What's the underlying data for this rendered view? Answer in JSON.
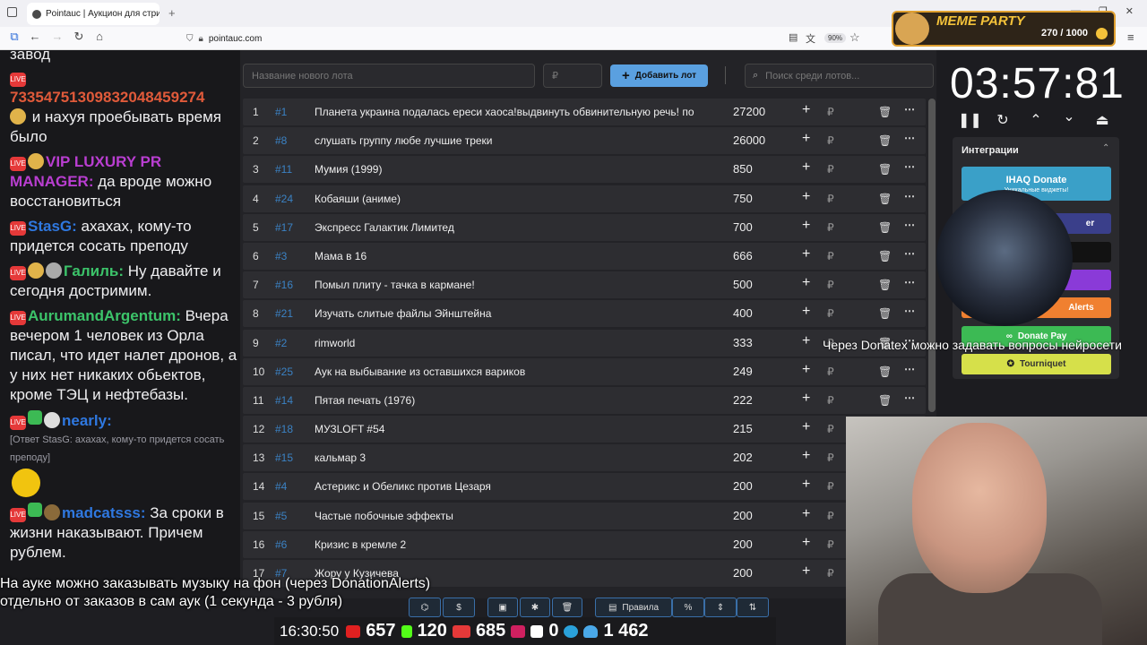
{
  "browser": {
    "tab_title": "Pointauc | Аукцион для стриме",
    "url": "pointauc.com",
    "zoom": "90%"
  },
  "meme_party": {
    "title": "MEME PARTY",
    "count": "270 / 1000"
  },
  "chat": {
    "top_word": "завод",
    "messages": [
      {
        "nick": "733547513098320484592​74",
        "nick_display": "7335475130983204845927​4",
        "color": "#e05a3a",
        "text": " и нахуя проебывать время было"
      },
      {
        "nick": "VIP LUXURY PR MANAGER:",
        "color": "#b93ed1",
        "text": " да вроде можно восстановиться"
      },
      {
        "nick": "StasG:",
        "color": "#2f78e0",
        "text": " ахахах, кому-то придется сосать преподу"
      },
      {
        "nick": "Галиль:",
        "color": "#3cc46a",
        "text": " Ну давайте и сегодня достримим."
      },
      {
        "nick": "AurumandArgentum:",
        "color": "#3cc46a",
        "text": " Вчера вечером 1 человек из Орла писал, что идет налет дронов, а у них нет никаких обьектов, кроме ТЭЦ и нефтебазы."
      },
      {
        "nick": "nearly:",
        "color": "#2f78e0",
        "text": ""
      },
      {
        "nick": "madcatsss:",
        "color": "#2f78e0",
        "text": " За сроки в жизни наказывают. Причем рублем."
      }
    ],
    "reply": "[Ответ StasG: ахахах, кому-то придется сосать преподу]"
  },
  "auction": {
    "lot_placeholder": "Название нового лота",
    "price_placeholder": "₽",
    "add_label": "Добавить лот",
    "search_placeholder": "Поиск среди лотов...",
    "lots": [
      {
        "n": "1",
        "id": "#1",
        "title": "Планета украина подалась ереси хаоса!выдвинуть обвинительную речь! по",
        "value": "27200"
      },
      {
        "n": "2",
        "id": "#8",
        "title": "слушать группу любе лучшие треки",
        "value": "26000"
      },
      {
        "n": "3",
        "id": "#11",
        "title": "Мумия (1999)",
        "value": "850"
      },
      {
        "n": "4",
        "id": "#24",
        "title": "Кобаяши (аниме)",
        "value": "750"
      },
      {
        "n": "5",
        "id": "#17",
        "title": "Экспресс Галактик Лимитед",
        "value": "700"
      },
      {
        "n": "6",
        "id": "#3",
        "title": "Мама в 16",
        "value": "666"
      },
      {
        "n": "7",
        "id": "#16",
        "title": "Помыл плиту - тачка в кармане!",
        "value": "500"
      },
      {
        "n": "8",
        "id": "#21",
        "title": "Изучать слитые файлы Эйнштейна",
        "value": "400"
      },
      {
        "n": "9",
        "id": "#2",
        "title": "rimworld",
        "value": "333"
      },
      {
        "n": "10",
        "id": "#25",
        "title": "Аук на выбывание из оставшихся вариков",
        "value": "249"
      },
      {
        "n": "11",
        "id": "#14",
        "title": "Пятая печать (1976)",
        "value": "222"
      },
      {
        "n": "12",
        "id": "#18",
        "title": "МУЗLOFT #54",
        "value": "215"
      },
      {
        "n": "13",
        "id": "#15",
        "title": "кальмар 3",
        "value": "202"
      },
      {
        "n": "14",
        "id": "#4",
        "title": "Астерикс и Обеликс против Цезаря",
        "value": "200"
      },
      {
        "n": "15",
        "id": "#5",
        "title": "Частые побочные эффекты",
        "value": "200"
      },
      {
        "n": "16",
        "id": "#6",
        "title": "Кризис в кремле 2",
        "value": "200"
      },
      {
        "n": "17",
        "id": "#7",
        "title": "Жору у Кузичева",
        "value": "200"
      }
    ],
    "rub": "₽"
  },
  "timer": {
    "value": "03:57:81"
  },
  "integrations": {
    "title": "Интеграции",
    "buttons": [
      {
        "label": "IHAQ Donate",
        "color": "#3aa0c8"
      },
      {
        "label": "er",
        "color": "#3a3f8a"
      },
      {
        "label": "",
        "color": "#1a1a1a"
      },
      {
        "label": "",
        "color": "#8a3ad8"
      },
      {
        "label": "Alerts",
        "color": "#f08030"
      },
      {
        "label": "Donate Pay",
        "color": "#3cba54"
      },
      {
        "label": "Tourniquet",
        "color": "#d6e04a"
      }
    ],
    "sub_text": "Уникальные виджеты!"
  },
  "overlay": {
    "ticker": "Через Donatex можно задавать вопросы нейросети",
    "subtitle_line1": "На ауке можно заказывать музыку на фон (через DonationAlerts)",
    "subtitle_line2": "отдельно от заказов в сам аук (1 секунда - 3 рубля)",
    "rules_label": "Правила"
  },
  "stats": {
    "clock": "16:30:50",
    "youtube": "657",
    "kick": "120",
    "vk": "685",
    "r": "0",
    "viewers": "1 462"
  }
}
